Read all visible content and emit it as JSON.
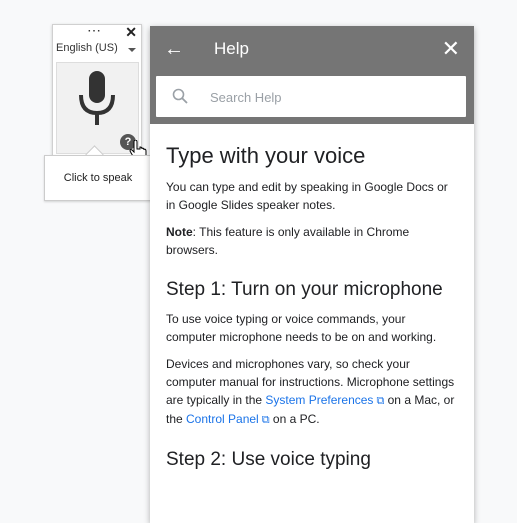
{
  "voice_widget": {
    "more_label": "⋯",
    "close_label": "✕",
    "language": "English (US)",
    "help_badge": "?",
    "tooltip": "Click to speak"
  },
  "help_panel": {
    "back_label": "←",
    "title": "Help",
    "close_label": "✕",
    "search_placeholder": "Search Help",
    "article": {
      "heading": "Type with your voice",
      "intro": "You can type and edit by speaking in Google Docs or in Google Slides speaker notes.",
      "note_label": "Note",
      "note_text": ": This feature is only available in Chrome browsers.",
      "step1_heading": "Step 1: Turn on your microphone",
      "step1_p1": "To use voice typing or voice commands, your computer microphone needs to be on and working.",
      "step1_p2_a": "Devices and microphones vary, so check your computer manual for instructions. Microphone settings are typically in the ",
      "link_system_prefs": "System Preferences",
      "step1_p2_b": " on a Mac, or the ",
      "link_control_panel": "Control Panel",
      "step1_p2_c": " on a PC.",
      "step2_heading": "Step 2: Use voice typing"
    }
  },
  "colors": {
    "header_bg": "#757575",
    "link": "#1a73e8",
    "page_bg": "#f8f9fa"
  }
}
